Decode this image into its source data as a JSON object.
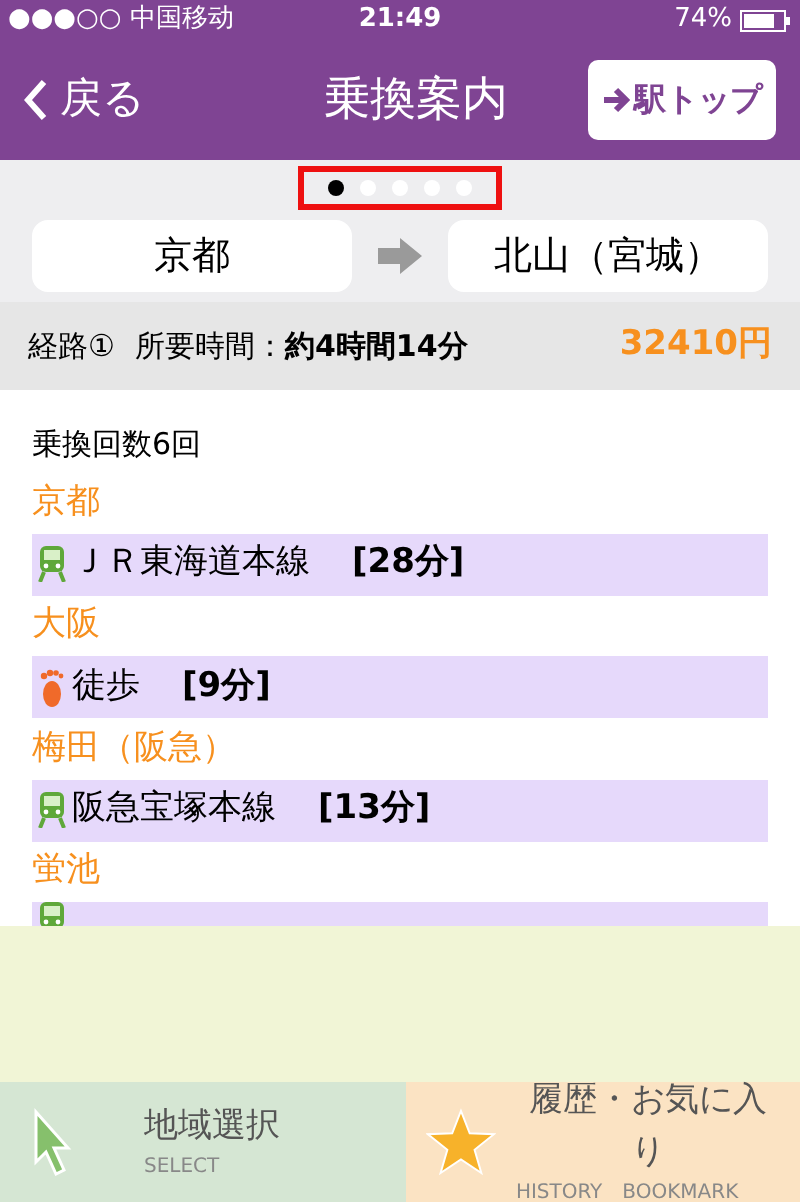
{
  "status_bar": {
    "carrier": "●●●○○ 中国移动",
    "time": "21:49",
    "battery": "74%"
  },
  "nav": {
    "back": "戻る",
    "title": "乗換案内",
    "station_top": "駅トップ"
  },
  "pager": [
    {
      "selected": true
    },
    {
      "selected": false
    },
    {
      "selected": false
    },
    {
      "selected": false
    },
    {
      "selected": false
    }
  ],
  "route": {
    "from": "京都",
    "to": "北山（宮城）"
  },
  "summary": {
    "label": "経路①",
    "duration_label": "所要時間：",
    "duration": "約4時間14分",
    "fare": "32410円"
  },
  "transfers": "乗換回数6回",
  "steps": [
    {
      "kind": "station",
      "name": "京都"
    },
    {
      "kind": "train",
      "line": "ＪＲ東海道本線",
      "time": "[28分]"
    },
    {
      "kind": "station",
      "name": "大阪"
    },
    {
      "kind": "walk",
      "line": "徒歩",
      "time": "[9分]"
    },
    {
      "kind": "station",
      "name": "梅田（阪急）"
    },
    {
      "kind": "train",
      "line": "阪急宝塚本線",
      "time": "[13分]"
    },
    {
      "kind": "station",
      "name": "蛍池"
    },
    {
      "kind": "train_cut"
    }
  ],
  "tabs": [
    {
      "kind": "select",
      "label": "地域選択",
      "sub": "SELECT"
    },
    {
      "kind": "history",
      "label": "履歴・お気に入り",
      "sub": "HISTORY　BOOKMARK"
    }
  ]
}
